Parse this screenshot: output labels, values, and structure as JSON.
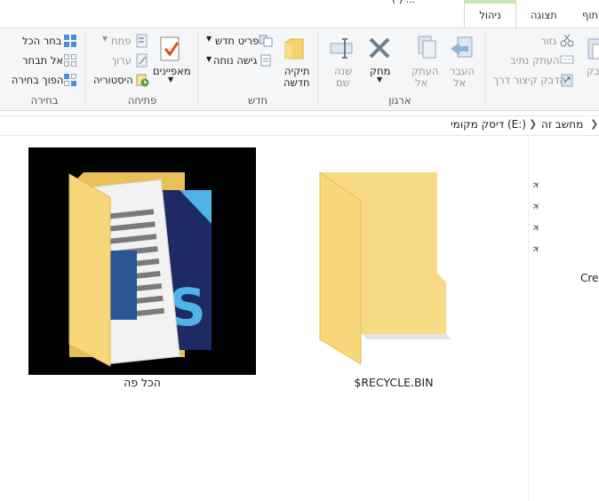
{
  "window": {
    "title_fragment": "( ) ..."
  },
  "tabs": [
    {
      "label": "ניהול",
      "active": true
    },
    {
      "label": "תצוגה",
      "active": false
    },
    {
      "label": "תוף",
      "active": false
    }
  ],
  "ribbon": {
    "groups": {
      "clipboard": {
        "cut": "גזור",
        "copy_path": "העתק נתיב",
        "paste_shortcut": "הדבק קיצור דרך",
        "paste_partial": "דבק"
      },
      "organize": {
        "label": "ארגון",
        "move_to": "העבר",
        "move_to_2": "אל",
        "copy_to": "העתק",
        "copy_to_2": "אל",
        "delete": "מחק",
        "rename": "שנה",
        "rename_2": "שם"
      },
      "new": {
        "label": "חדש",
        "new_item": "פריט חדש",
        "easy_access": "גישה נוחה",
        "new_folder": "תיקיה",
        "new_folder_2": "חדשה"
      },
      "open": {
        "label": "פתיחה",
        "open": "פתח",
        "edit": "ערוך",
        "history": "היסטוריה",
        "properties": "מאפיינים"
      },
      "select": {
        "label": "בחירה",
        "select_all": "בחר הכל",
        "select_none": "אל תבחר",
        "invert": "הפוך בחירה"
      }
    }
  },
  "address": {
    "crumbs": [
      "מחשב זה",
      "דיסק מקומי (E:)"
    ]
  },
  "nav": {
    "partial_label": "Crea"
  },
  "files": [
    {
      "name": "הכל פה",
      "type": "folder-with-documents"
    },
    {
      "name": "$RECYCLE.BIN",
      "type": "folder"
    }
  ],
  "colors": {
    "manage_tab_accent": "#c8ecaa",
    "folder_yellow": "#f5d26b",
    "ribbon_bg": "#f5f6f7"
  }
}
